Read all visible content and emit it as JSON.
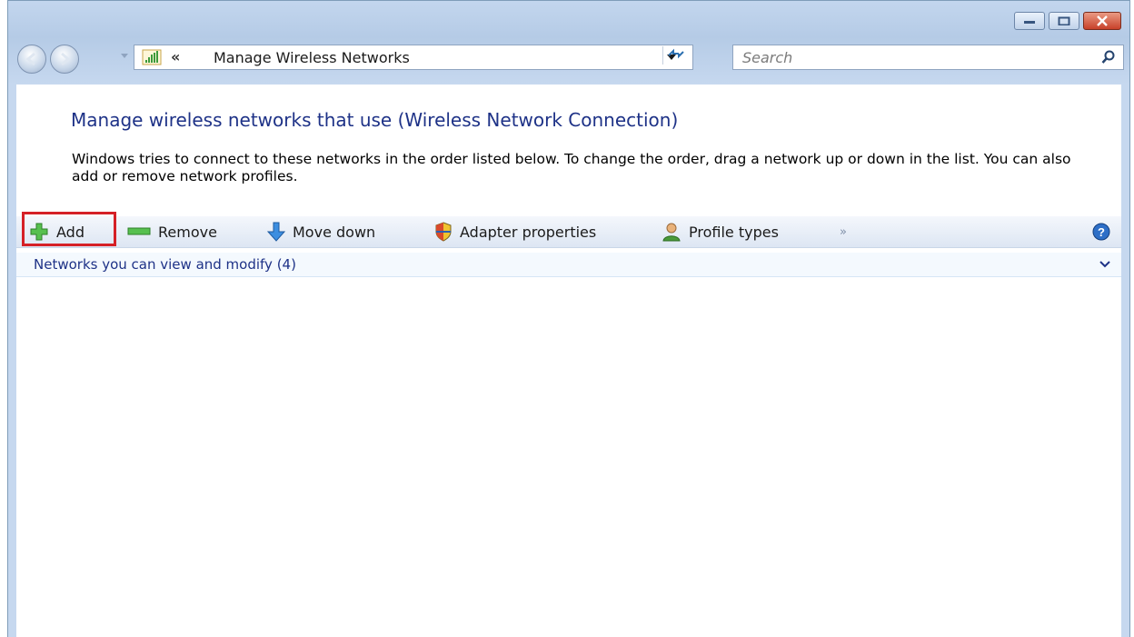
{
  "address": {
    "path_prefix": "«",
    "location": "Manage Wireless Networks"
  },
  "search": {
    "placeholder": "Search"
  },
  "content": {
    "heading": "Manage wireless networks that use (Wireless Network Connection)",
    "description": "Windows tries to connect to these networks in the order listed below. To change the order, drag a network up or down in the list. You can also add or remove network profiles."
  },
  "toolbar": {
    "add": "Add",
    "remove": "Remove",
    "move_down": "Move down",
    "adapter_properties": "Adapter properties",
    "profile_types": "Profile types",
    "overflow": "»"
  },
  "list": {
    "group_header": "Networks you can view and modify (4)"
  },
  "colors": {
    "heading": "#1e3287",
    "highlight": "#d52026",
    "add_green": "#3fa63a",
    "move_blue": "#2e7ed1"
  },
  "icons": [
    "back-icon",
    "forward-icon",
    "wireless-network-icon",
    "dropdown-icon",
    "refresh-icon",
    "search-icon",
    "add-icon",
    "remove-icon",
    "move-down-icon",
    "shield-icon",
    "user-icon",
    "help-icon",
    "chevron-down-icon"
  ]
}
